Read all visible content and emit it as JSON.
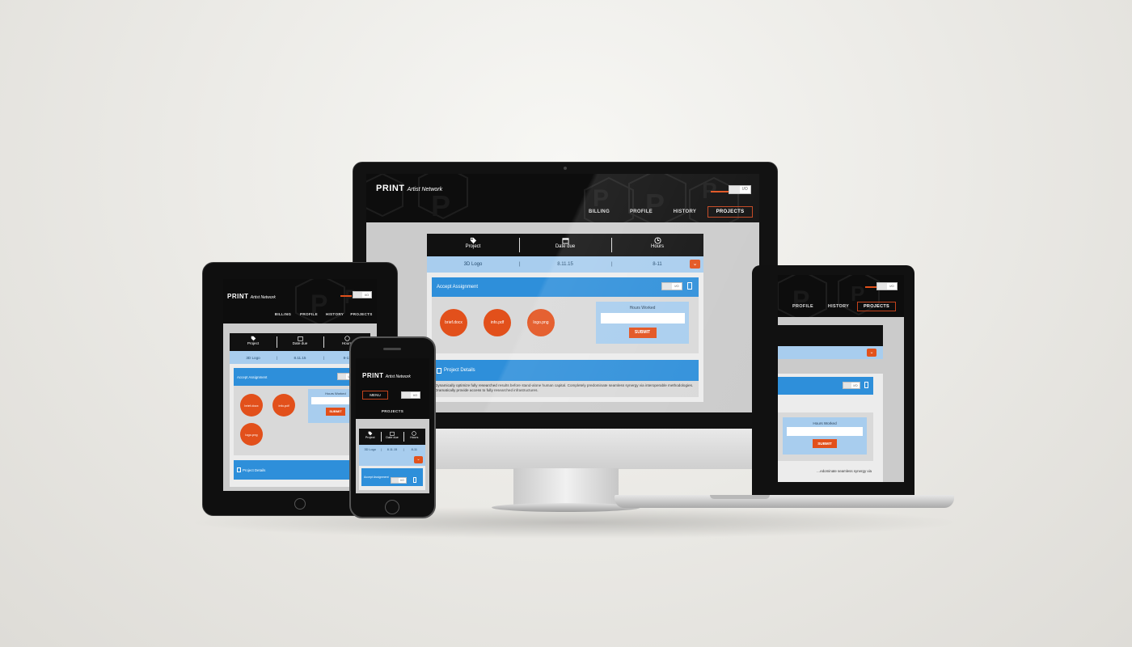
{
  "brand": {
    "name": "PRINT",
    "tagline": "Artist Network"
  },
  "nav": {
    "billing": "BILLING",
    "profile": "PROFILE",
    "history": "HISTORY",
    "projects": "PROJECTS",
    "menu": "MENU"
  },
  "toggle": {
    "label": "I/O"
  },
  "table": {
    "headers": [
      {
        "label": "Project",
        "icon": "tag-icon"
      },
      {
        "label": "Date due",
        "icon": "calendar-icon"
      },
      {
        "label": "Hours",
        "icon": "clock-icon"
      }
    ],
    "row": {
      "project": "3D Logo",
      "date": "8.11.15",
      "hours": "8-11"
    }
  },
  "assignment": {
    "title": "Accept Assignment",
    "files": [
      "brief.docx",
      "info.pdf",
      "logo.png"
    ],
    "hours_label": "Hours Worked",
    "submit_label": "SUBMIT"
  },
  "details": {
    "title": "Project Details",
    "body": "Dynamically optimize fully researched results before stand-alone human capital. Completely predominate seamless synergy via interoperable methodologies. Dramatically provide access to fully researched infrastructures."
  },
  "colors": {
    "accent": "#e2501b",
    "blue": "#2e8fda",
    "light_blue": "#a8cdee",
    "header": "#0d0d0d"
  }
}
